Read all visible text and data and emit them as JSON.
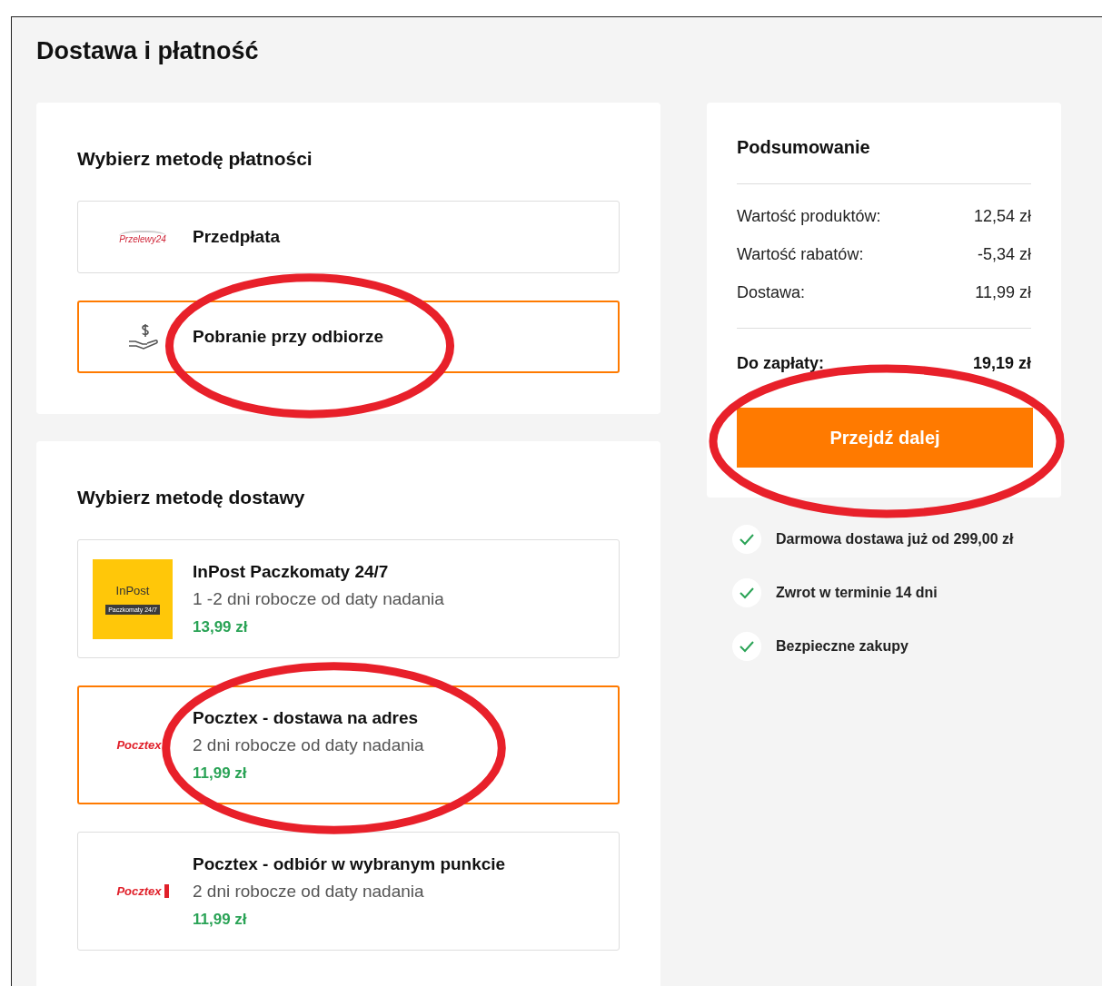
{
  "page": {
    "title": "Dostawa i płatność"
  },
  "payment": {
    "heading": "Wybierz metodę płatności",
    "options": [
      {
        "kind": "przelewy",
        "logo_text": "Przelewy24",
        "title": "Przedpłata",
        "selected": false,
        "circled": false
      },
      {
        "kind": "cash",
        "title": "Pobranie przy odbiorze",
        "selected": true,
        "circled": true
      }
    ]
  },
  "delivery": {
    "heading": "Wybierz metodę dostawy",
    "options": [
      {
        "kind": "inpost",
        "logo_text": "InPost",
        "logo_subtext": "Paczkomaty 24/7",
        "title": "InPost Paczkomaty 24/7",
        "subtitle": "1 -2 dni robocze od daty nadania",
        "price": "13,99 zł",
        "selected": false,
        "circled": false
      },
      {
        "kind": "pocztex",
        "logo_text": "Pocztex",
        "title": "Pocztex - dostawa na adres",
        "subtitle": "2 dni robocze od daty nadania",
        "price": "11,99 zł",
        "selected": true,
        "circled": true
      },
      {
        "kind": "pocztex",
        "logo_text": "Pocztex",
        "title": "Pocztex - odbiór w wybranym punkcie",
        "subtitle": "2 dni robocze od daty nadania",
        "price": "11,99 zł",
        "selected": false,
        "circled": false
      }
    ]
  },
  "summary": {
    "title": "Podsumowanie",
    "rows": [
      {
        "label": "Wartość produktów:",
        "value": "12,54 zł"
      },
      {
        "label": "Wartość rabatów:",
        "value": "-5,34 zł"
      },
      {
        "label": "Dostawa:",
        "value": "11,99 zł"
      }
    ],
    "total_label": "Do zapłaty:",
    "total_value": "19,19 zł",
    "button": {
      "label": "Przejdź dalej",
      "circled": true
    }
  },
  "benefits": [
    "Darmowa dostawa już od 299,00 zł",
    "Zwrot w terminie 14 dni",
    "Bezpieczne zakupy"
  ]
}
